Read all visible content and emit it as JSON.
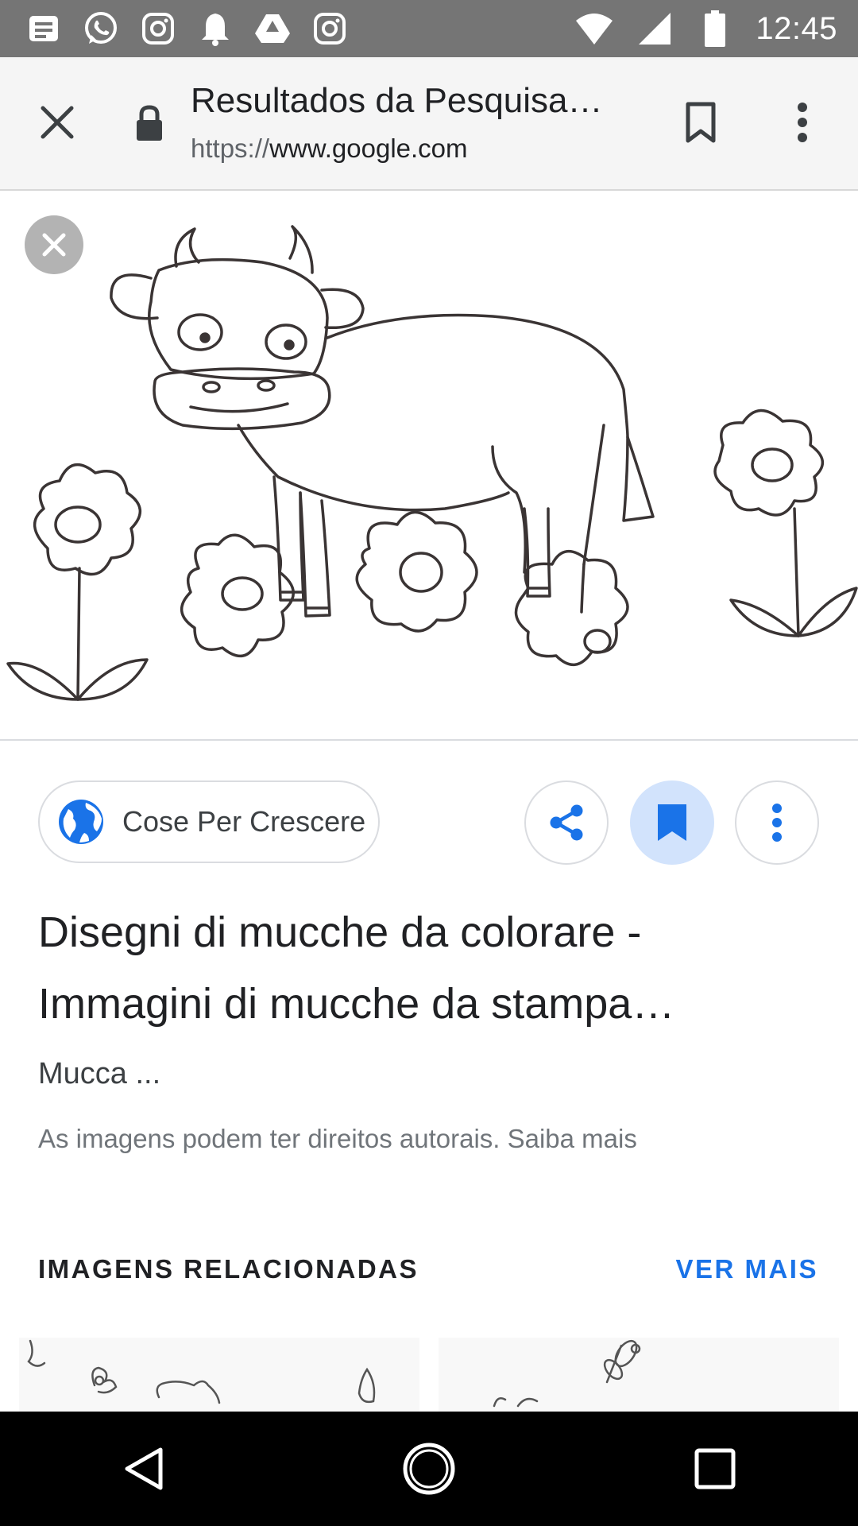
{
  "status_bar": {
    "time": "12:45",
    "left_icons": [
      "notification-icon",
      "whatsapp-icon",
      "instagram-icon",
      "bell-icon",
      "drive-icon",
      "instagram-icon"
    ],
    "right_icons": [
      "wifi-icon",
      "signal-icon",
      "battery-icon"
    ]
  },
  "toolbar": {
    "title": "Resultados da Pesquisa…",
    "url_scheme": "https://",
    "url_domain": "www.google.com"
  },
  "result": {
    "source_label": "Cose Per Crescere",
    "title": "Disegni di mucche da colorare - Immagini di mucche da stampa…",
    "subtitle": "Mucca ...",
    "copyright": "As imagens podem ter direitos autorais. Saiba mais"
  },
  "related": {
    "header": "IMAGENS RELACIONADAS",
    "more_label": "VER MAIS"
  },
  "colors": {
    "accent": "#1a73e8",
    "status_bar": "#757575",
    "saved_bg": "#d2e3fc"
  }
}
